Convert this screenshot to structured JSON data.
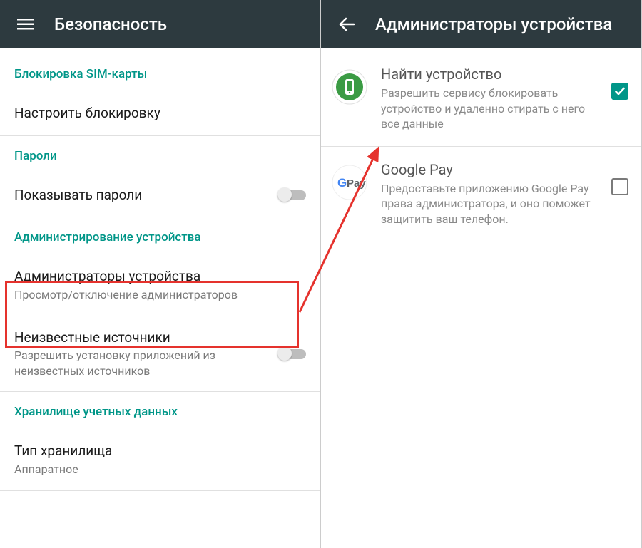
{
  "left": {
    "appbar_title": "Безопасность",
    "section_sim": "Блокировка SIM-карты",
    "row_configure_lock": "Настроить блокировку",
    "section_passwords": "Пароли",
    "row_show_passwords": "Показывать пароли",
    "section_admin": "Администрирование устройства",
    "row_admins_title": "Администраторы устройства",
    "row_admins_sub": "Просмотр/отключение администраторов",
    "row_unknown_title": "Неизвестные источники",
    "row_unknown_sub": "Разрешить установку приложений из неизвестных источников",
    "section_credentials": "Хранилище учетных данных",
    "row_storage_title": "Тип хранилища",
    "row_storage_sub": "Аппаратное"
  },
  "right": {
    "appbar_title": "Администраторы устройства",
    "items": [
      {
        "title": "Найти устройство",
        "desc": "Разрешить сервису блокировать устройство и удаленно стирать с него все данные",
        "checked": true
      },
      {
        "title": "Google Pay",
        "desc": "Предоставьте приложению Google Pay права администратора, и оно поможет защитить ваш телефон.",
        "checked": false
      }
    ]
  },
  "colors": {
    "accent": "#009688",
    "appbar": "#2d3a3f",
    "highlight": "#e5322d"
  }
}
